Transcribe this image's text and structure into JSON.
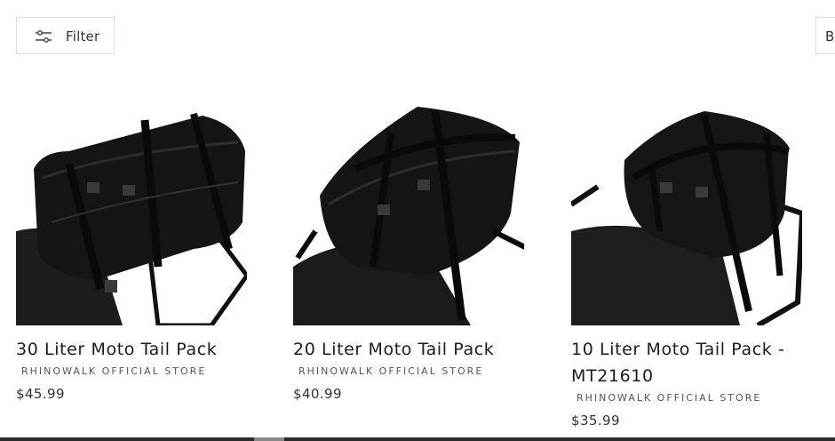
{
  "toolbar": {
    "filter_label": "Filter",
    "sort_label": "Be"
  },
  "products": [
    {
      "title": "30 Liter Moto Tail Pack",
      "vendor": "RHINOWALK OFFICIAL STORE",
      "price": "$45.99"
    },
    {
      "title": "20 Liter Moto Tail Pack",
      "vendor": "RHINOWALK OFFICIAL STORE",
      "price": "$40.99"
    },
    {
      "title": "10 Liter Moto Tail Pack - MT21610",
      "vendor": "RHINOWALK OFFICIAL STORE",
      "price": "$35.99"
    }
  ],
  "icons": {
    "filter": "sliders-icon"
  }
}
